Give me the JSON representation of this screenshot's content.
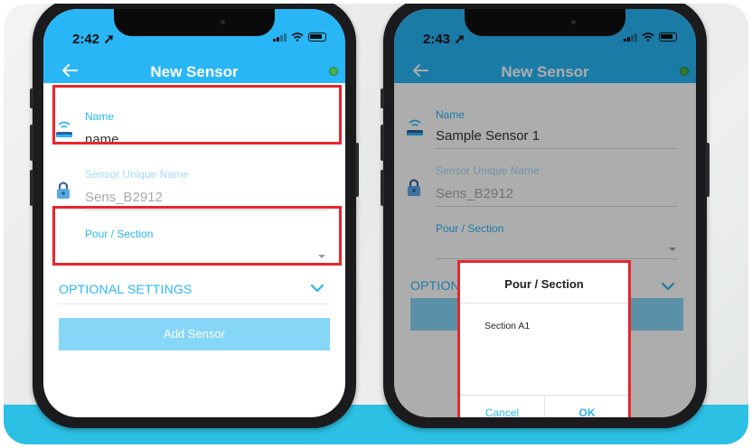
{
  "colors": {
    "accent": "#29b6f6",
    "highlight_red": "#e8252c",
    "band_cyan": "#2bc0e4",
    "online_green": "#4caf50"
  },
  "left_phone": {
    "status_time": "2:42",
    "header_title": "New Sensor",
    "name_label": "Name",
    "name_placeholder": "name",
    "unique_name_label": "Sensor Unique Name",
    "unique_name_value": "Sens_B2912",
    "pour_label": "Pour / Section",
    "optional_settings": "OPTIONAL SETTINGS",
    "add_sensor": "Add Sensor"
  },
  "right_phone": {
    "status_time": "2:43",
    "header_title": "New Sensor",
    "name_label": "Name",
    "name_value": "Sample Sensor 1",
    "unique_name_label": "Sensor Unique Name",
    "unique_name_value": "Sens_B2912",
    "pour_label": "Pour / Section",
    "optional_settings_partial": "OPTION",
    "dialog": {
      "title": "Pour / Section",
      "options": [
        "Section A1"
      ],
      "cancel": "Cancel",
      "ok": "OK"
    }
  }
}
